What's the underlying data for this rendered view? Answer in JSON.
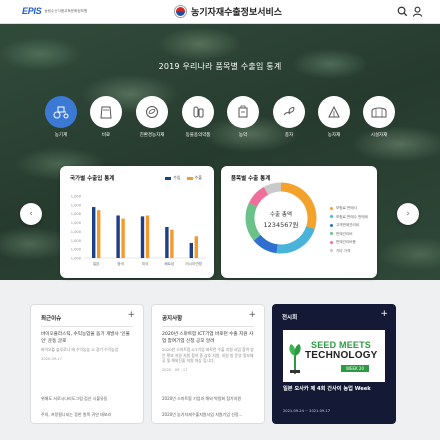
{
  "header": {
    "logo_mark": "EPIS",
    "logo_sub": "농림수산식품교육문화정보원",
    "site_title": "농기자재수출정보서비스"
  },
  "hero": {
    "title": "2019 우리나라 품목별 수출입 통계",
    "categories": [
      {
        "label": "농기계",
        "icon": "tractor-icon"
      },
      {
        "label": "비료",
        "icon": "fertilizer-bag-icon"
      },
      {
        "label": "친환경농자재",
        "icon": "eco-material-icon"
      },
      {
        "label": "동물용의약품",
        "icon": "veterinary-medicine-icon"
      },
      {
        "label": "농약",
        "icon": "pesticide-icon"
      },
      {
        "label": "종자",
        "icon": "seed-icon"
      },
      {
        "label": "농자재",
        "icon": "farm-material-icon"
      },
      {
        "label": "시설자재",
        "icon": "greenhouse-icon"
      }
    ]
  },
  "trade_card": {
    "title": "국가별 수출입 통계",
    "legend_export": "수입",
    "legend_import": "수출"
  },
  "item_card": {
    "title": "품목별 수출 통계",
    "center_label": "수출 총액",
    "center_value": "1234567원",
    "legend": [
      "보험료 판매사",
      "보험료 판매수 판매비",
      "고객판매관리비",
      "판매관리비",
      "판매관리비용",
      "기타 가격"
    ]
  },
  "chart_data": [
    {
      "type": "bar",
      "title": "국가별 수출입 통계",
      "categories": [
        "일본",
        "중국",
        "미국",
        "베트남",
        "러시아연방"
      ],
      "series": [
        {
          "name": "수입",
          "values": [
            1150,
            960,
            940,
            700,
            340
          ]
        },
        {
          "name": "수출",
          "values": [
            1080,
            890,
            960,
            640,
            490
          ]
        }
      ],
      "yticks": [
        "1,000",
        "1,000",
        "1,000",
        "1,000",
        "1,000",
        "1,000",
        "1,000",
        "1,000"
      ],
      "ylim": [
        0,
        1400
      ],
      "colors": {
        "수입": "#1d3f86",
        "수출": "#f29a2e"
      }
    },
    {
      "type": "pie",
      "title": "품목별 수출 통계",
      "labels": [
        "보험료 판매사",
        "보험료 판매수 판매비",
        "고객판매관리비",
        "판매관리비",
        "판매관리비용",
        "기타 가격"
      ],
      "values": [
        30,
        22,
        12,
        18,
        10,
        8
      ],
      "colors": [
        "#f3a22c",
        "#4ab3d9",
        "#2f6fd0",
        "#6bc18a",
        "#f06f9a",
        "#c9c9c9"
      ]
    }
  ],
  "panels": {
    "news": {
      "title": "최근이슈",
      "feature_title": "바이오플라스틱, 수익농업을 돕기 개발사 '인불인' 운동 글로",
      "feature_desc": "바이오플 솔루로나 에 수익농농 소 광기 수익농업",
      "feature_date": "2020-09-17",
      "items": [
        "위해도 서로시나리도그림 검산 시불유동",
        "주의, 프랑필나되는 증한 원폭 귀안 테보리"
      ]
    },
    "notice": {
      "title": "공지사항",
      "feature_title": "2020년 스마트팜 ICT기업 바로런 수출 지원 사업 참여기업 신청 공모 알려",
      "feature_desc": "2020년 스마트팜 ICT기업 바로런 수출 지원 사업 참여 방안 확보 지원 지원 참여 중 상호 지원, 지원 방 운영 정보제공 및 해외진출 지원 대상 입니다.",
      "feature_date": "2020 - 09 - 17",
      "items": [
        "2020년 스마트팜 기업과 해외 박람회 참가지원",
        "2020년 농기자재수출지원사업 지원기업 선정..."
      ]
    },
    "exhibition": {
      "title": "전시회",
      "banner_line1": "SEED MEETS",
      "banner_line2": "TECHNOLOGY",
      "banner_tag": "WEEK 20",
      "event_title": "일본 오사카 제 4회 간사이 농업 Week",
      "event_date": "2021-09-24 ~ 2021-09-17"
    }
  }
}
